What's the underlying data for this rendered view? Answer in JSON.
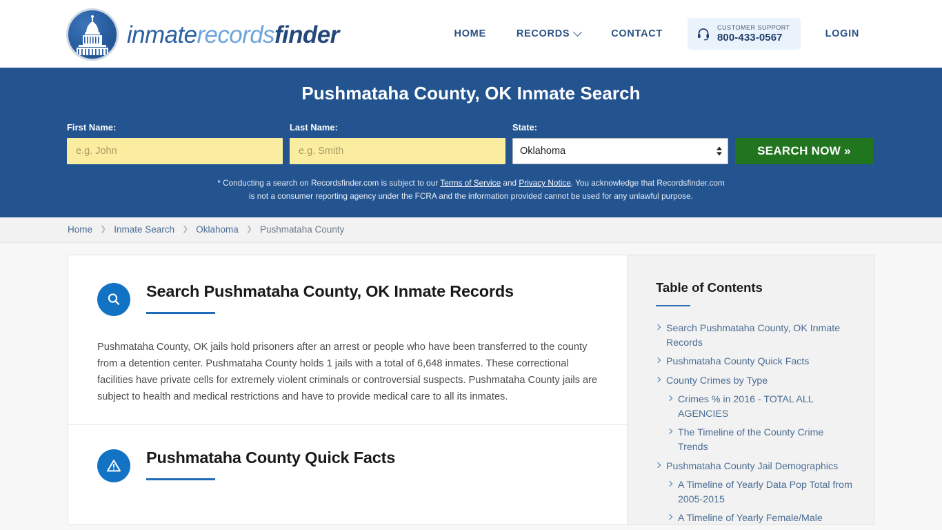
{
  "header": {
    "logo": {
      "icon": "capitol-dome-icon",
      "part1": "inmate",
      "part2": "records",
      "part3": "finder"
    },
    "nav": [
      {
        "label": "HOME",
        "name": "nav-home"
      },
      {
        "label": "RECORDS",
        "name": "nav-records",
        "has_chevron": true
      },
      {
        "label": "CONTACT",
        "name": "nav-contact"
      }
    ],
    "support": {
      "icon": "headset-icon",
      "label": "CUSTOMER SUPPORT",
      "phone": "800-433-0567"
    },
    "login_label": "LOGIN"
  },
  "hero": {
    "title": "Pushmataha County, OK Inmate Search",
    "first_name": {
      "label": "First Name:",
      "value": "",
      "placeholder": "e.g. John"
    },
    "last_name": {
      "label": "Last Name:",
      "value": "",
      "placeholder": "e.g. Smith"
    },
    "state": {
      "label": "State:",
      "value": "Oklahoma",
      "options": [
        "Oklahoma"
      ]
    },
    "search_button": "SEARCH NOW »",
    "disclaimer": {
      "line1_a": "* Conducting a search on Recordsfinder.com is subject to our ",
      "link1": "Terms of Service",
      "line1_b": " and ",
      "link2": "Privacy Notice",
      "line1_c": ". You acknowledge that Recordsfinder.com",
      "line2": "is not a consumer reporting agency under the FCRA and the information provided cannot be used for any unlawful purpose."
    }
  },
  "breadcrumb": {
    "separator": "❯",
    "items": [
      {
        "label": "Home"
      },
      {
        "label": "Inmate Search"
      },
      {
        "label": "Oklahoma"
      },
      {
        "label": "Pushmataha County"
      }
    ]
  },
  "main": {
    "sections": [
      {
        "icon": "search-circle-icon",
        "title": "Search Pushmataha County, OK Inmate Records",
        "body": "Pushmataha County, OK jails hold prisoners after an arrest or people who have been transferred to the county from a detention center. Pushmataha County holds 1 jails with a total of 6,648 inmates. These correctional facilities have private cells for extremely violent criminals or controversial suspects. Pushmataha County jails are subject to health and medical restrictions and have to provide medical care to all its inmates."
      },
      {
        "icon": "warning-circle-icon",
        "title": "Pushmataha County Quick Facts",
        "body": ""
      }
    ]
  },
  "sidebar": {
    "title": "Table of Contents",
    "items": [
      {
        "label": "Search Pushmataha County, OK Inmate Records",
        "level": 1
      },
      {
        "label": "Pushmataha County Quick Facts",
        "level": 1
      },
      {
        "label": "County Crimes by Type",
        "level": 1
      },
      {
        "label": "Crimes % in 2016 - TOTAL ALL AGENCIES",
        "level": 2
      },
      {
        "label": "The Timeline of the County Crime Trends",
        "level": 2
      },
      {
        "label": "Pushmataha County Jail Demographics",
        "level": 1
      },
      {
        "label": "A Timeline of Yearly Data Pop Total from 2005-2015",
        "level": 2
      },
      {
        "label": "A Timeline of Yearly Female/Male",
        "level": 2
      }
    ]
  },
  "colors": {
    "hero_blue": "#235490",
    "accent_blue": "#1273c4",
    "link_blue": "#4a6c93",
    "button_green": "#21751f",
    "input_yellow": "#fbeda0"
  }
}
